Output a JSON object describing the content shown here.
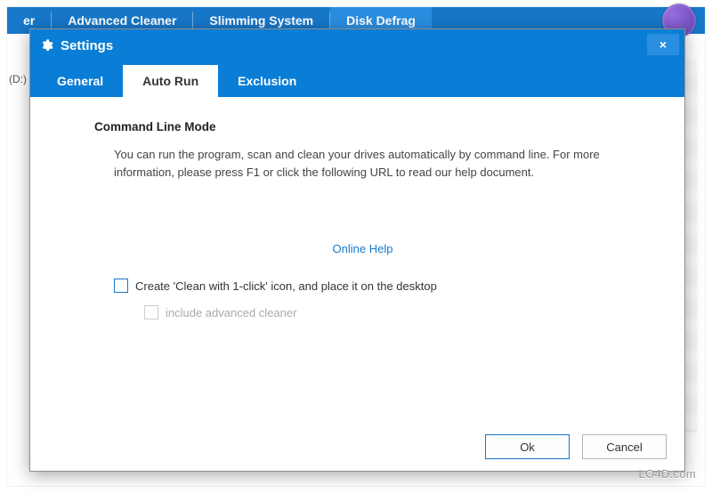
{
  "ribbon": {
    "items": [
      {
        "label": "er"
      },
      {
        "label": "Advanced Cleaner"
      },
      {
        "label": "Slimming System"
      },
      {
        "label": "Disk Defrag",
        "active": true
      }
    ]
  },
  "background": {
    "drive_label": "(D:)"
  },
  "dialog": {
    "title": "Settings",
    "close": "×",
    "tabs": [
      {
        "label": "General"
      },
      {
        "label": "Auto Run",
        "active": true
      },
      {
        "label": "Exclusion"
      }
    ],
    "section_title": "Command Line Mode",
    "paragraph": "You can run the program, scan and clean your drives automatically by command line. For more information, please press F1 or click the following URL to read our help document.",
    "link": "Online Help",
    "checkbox1_label": "Create 'Clean with 1-click' icon, and place it on the desktop",
    "checkbox2_label": "include advanced cleaner",
    "ok": "Ok",
    "cancel": "Cancel"
  },
  "watermark": "LO4D.com"
}
